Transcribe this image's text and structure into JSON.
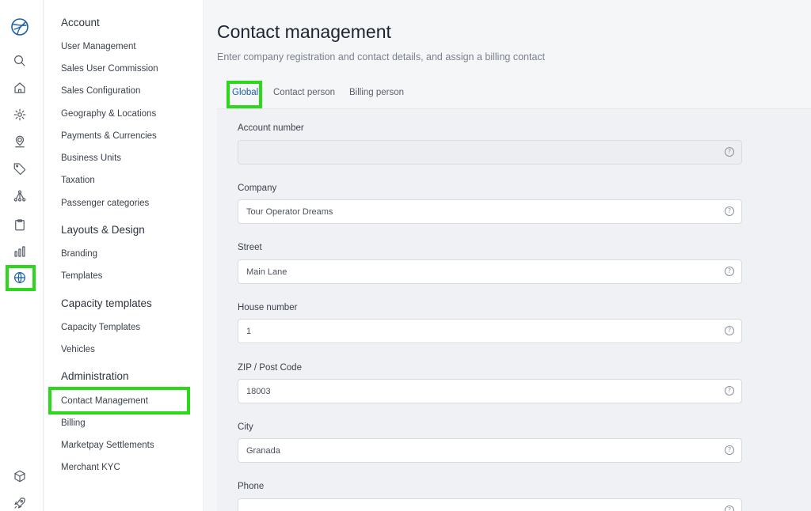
{
  "rail": {
    "icons": [
      "brand-logo",
      "search-icon",
      "home-icon",
      "gear-icon",
      "user-pin-icon",
      "tag-icon",
      "network-icon",
      "clipboard-icon",
      "chart-icon",
      "globe-icon",
      "box-icon",
      "rocket-icon"
    ],
    "active": "globe-icon",
    "accent": "#1b5fa8",
    "highlight": "#2bd91a"
  },
  "sidebar": {
    "groups": [
      {
        "title": "Account",
        "items": [
          "User Management",
          "Sales User Commission",
          "Sales Configuration",
          "Geography & Locations",
          "Payments & Currencies",
          "Business Units",
          "Taxation",
          "Passenger categories"
        ]
      },
      {
        "title": "Layouts & Design",
        "items": [
          "Branding",
          "Templates"
        ]
      },
      {
        "title": "Capacity templates",
        "items": [
          "Capacity Templates",
          "Vehicles"
        ]
      },
      {
        "title": "Administration",
        "items": [
          "Contact Management",
          "Billing",
          "Marketpay Settlements",
          "Merchant KYC"
        ]
      }
    ],
    "selected": "Contact Management"
  },
  "page": {
    "title": "Contact management",
    "subtitle": "Enter company registration and contact details, and assign a billing contact"
  },
  "tabs": [
    {
      "label": "Global",
      "active": true
    },
    {
      "label": "Contact person",
      "active": false
    },
    {
      "label": "Billing person",
      "active": false
    }
  ],
  "form": {
    "fields": [
      {
        "label": "Account number",
        "value": "",
        "disabled": true
      },
      {
        "label": "Company",
        "value": "Tour Operator Dreams",
        "disabled": false
      },
      {
        "label": "Street",
        "value": "Main Lane",
        "disabled": false
      },
      {
        "label": "House number",
        "value": "1",
        "disabled": false
      },
      {
        "label": "ZIP / Post Code",
        "value": "18003",
        "disabled": false
      },
      {
        "label": "City",
        "value": "Granada",
        "disabled": false
      },
      {
        "label": "Phone",
        "value": "",
        "disabled": false
      }
    ],
    "help_icon": "?"
  }
}
